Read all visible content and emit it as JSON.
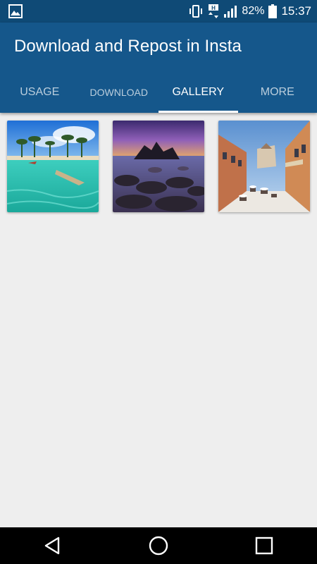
{
  "status_bar": {
    "battery_percent": "82%",
    "time": "15:37",
    "icons": [
      "image-notification-icon",
      "vibrate-icon",
      "data-transfer-icon",
      "signal-icon",
      "battery-icon"
    ]
  },
  "app_bar": {
    "title": "Download and Repost in Insta"
  },
  "tabs": [
    {
      "label": "USAGE",
      "active": false
    },
    {
      "label": "DOWNLOAD",
      "active": false
    },
    {
      "label": "GALLERY",
      "active": true
    },
    {
      "label": "MORE",
      "active": false
    }
  ],
  "gallery": {
    "items": [
      {
        "subject": "tropical-beach-boat"
      },
      {
        "subject": "rocky-coast-sunset"
      },
      {
        "subject": "snowy-street-cafe"
      }
    ]
  },
  "nav_bar": {
    "buttons": [
      "back-icon",
      "home-icon",
      "recents-icon"
    ]
  },
  "colors": {
    "status_bar": "#0f4a76",
    "app_bar": "#15578b",
    "background": "#eeeeee",
    "tab_indicator": "#ffffff"
  }
}
